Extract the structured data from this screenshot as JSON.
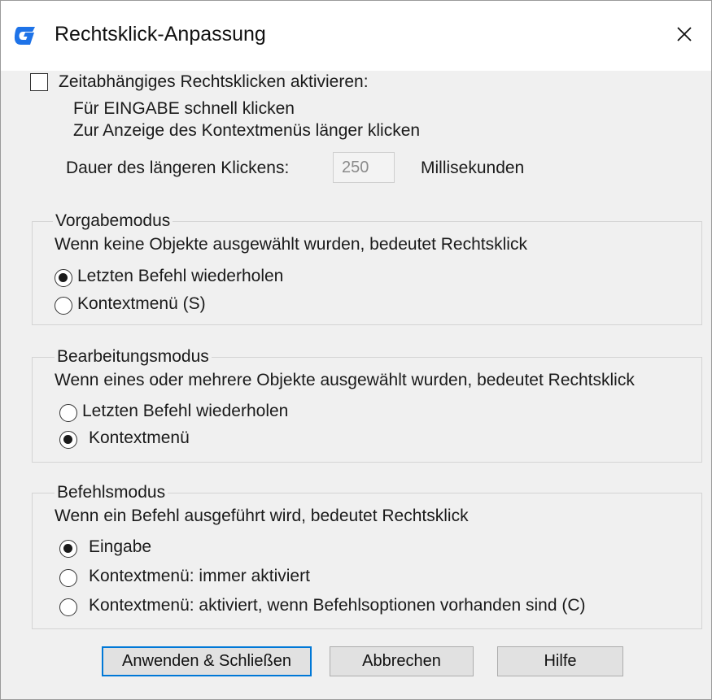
{
  "window": {
    "title": "Rechtsklick-Anpassung",
    "app_icon": "gstarcad-logo-icon",
    "close_icon": "close-icon",
    "accent_color": "#0078d7"
  },
  "timed": {
    "checkbox_label": "Zeitabhängiges Rechtsklicken aktivieren:",
    "checked": false,
    "hint1": "Für EINGABE schnell klicken",
    "hint2": "Zur Anzeige des Kontextmenüs länger klicken",
    "duration_label": "Dauer des längeren Klickens:",
    "duration_value": "250",
    "unit": "Millisekunden"
  },
  "default_mode": {
    "legend": "Vorgabemodus",
    "description": "Wenn keine Objekte ausgewählt wurden, bedeutet Rechtsklick",
    "options": [
      "Letzten Befehl wiederholen",
      "Kontextmenü (S)"
    ],
    "selected": 0
  },
  "edit_mode": {
    "legend": "Bearbeitungsmodus",
    "description": "Wenn eines oder mehrere Objekte ausgewählt wurden, bedeutet Rechtsklick",
    "options": [
      "Letzten Befehl wiederholen",
      "Kontextmenü"
    ],
    "selected": 1
  },
  "command_mode": {
    "legend": "Befehlsmodus",
    "description": "Wenn ein Befehl ausgeführt wird, bedeutet Rechtsklick",
    "options": [
      "Eingabe",
      "Kontextmenü: immer aktiviert",
      "Kontextmenü: aktiviert, wenn Befehlsoptionen vorhanden sind (C)"
    ],
    "selected": 0
  },
  "buttons": {
    "apply": "Anwenden & Schließen",
    "cancel": "Abbrechen",
    "help": "Hilfe"
  }
}
